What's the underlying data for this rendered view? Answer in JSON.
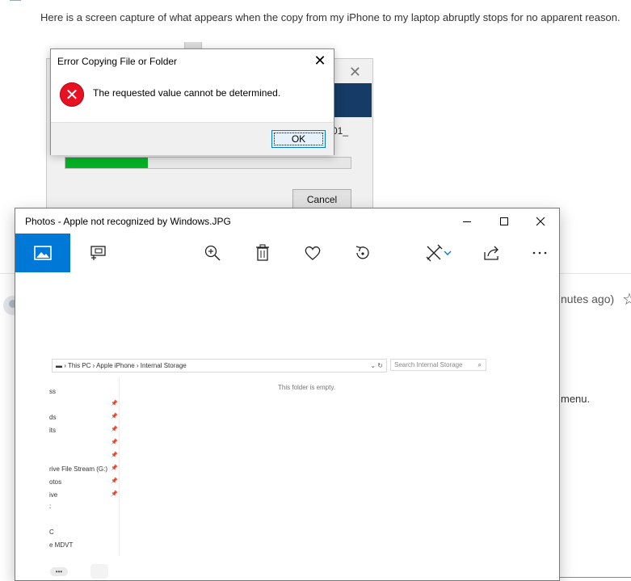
{
  "page": {
    "intro_text": "Here is a screen capture of what appears when the copy from my iPhone to my laptop abruptly stops for no apparent reason.",
    "timestamp_fragment": "nutes ago)",
    "menu_fragment": "menu."
  },
  "copy_dialog": {
    "file_fragment": "01_",
    "progress_fraction": 0.29,
    "cancel_label": "Cancel",
    "close_glyph": "✕"
  },
  "error_dialog": {
    "title": "Error Copying File or Folder",
    "message": "The requested value cannot be determined.",
    "ok_label": "OK",
    "close_glyph": "✕"
  },
  "photos": {
    "title": "Photos - Apple not recognized by Windows.JPG",
    "icons": [
      "image-icon",
      "slideshow-icon",
      "zoom-in-icon",
      "delete-icon",
      "favorite-icon",
      "rotate-icon",
      "edit-icon",
      "chevron-down-icon",
      "share-icon",
      "more-icon"
    ],
    "accent": "#0078d7"
  },
  "explorer": {
    "breadcrumb": "▬  ›  This PC  ›  Apple iPhone  ›  Internal Storage",
    "search_placeholder": "Search Internal Storage",
    "empty_text": "This folder is empty.",
    "nav_items": [
      "ss",
      "ds",
      "its",
      "rive File Stream (G:)",
      "otos",
      "ive",
      ":",
      "C",
      "e MDVT"
    ],
    "more_label": "•••"
  }
}
